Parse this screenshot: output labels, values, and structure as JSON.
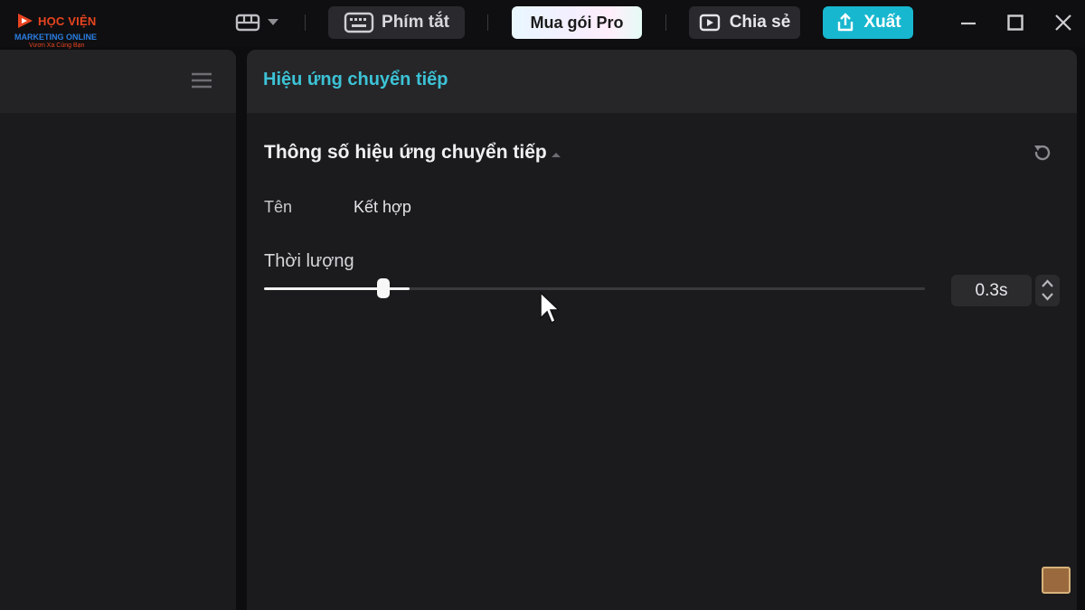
{
  "logo": {
    "line1": "HỌC VIỆN",
    "line2": "MARKETING ONLINE",
    "line3": "Vươn Xa Cùng Bạn"
  },
  "toolbar": {
    "shortcuts_label": "Phím tắt",
    "pro_label": "Mua gói Pro",
    "share_label": "Chia sẻ",
    "export_label": "Xuất"
  },
  "panel": {
    "title": "Hiệu ứng chuyển tiếp",
    "section_title": "Thông số hiệu ứng chuyển tiếp",
    "name_label": "Tên",
    "name_value": "Kết hợp",
    "duration_label": "Thời lượng",
    "duration_value": "0.3s",
    "duration_fraction": 0.22
  },
  "colors": {
    "accent": "#3cc3d6",
    "export": "#17b7cf",
    "logo_red": "#e8441f",
    "logo_blue": "#2a7de1"
  },
  "icons": {
    "layout": "layout-grid-icon",
    "keyboard": "keyboard-icon",
    "share": "share-video-icon",
    "export": "export-upload-icon",
    "reset": "reset-icon",
    "menu": "hamburger-menu-icon"
  }
}
